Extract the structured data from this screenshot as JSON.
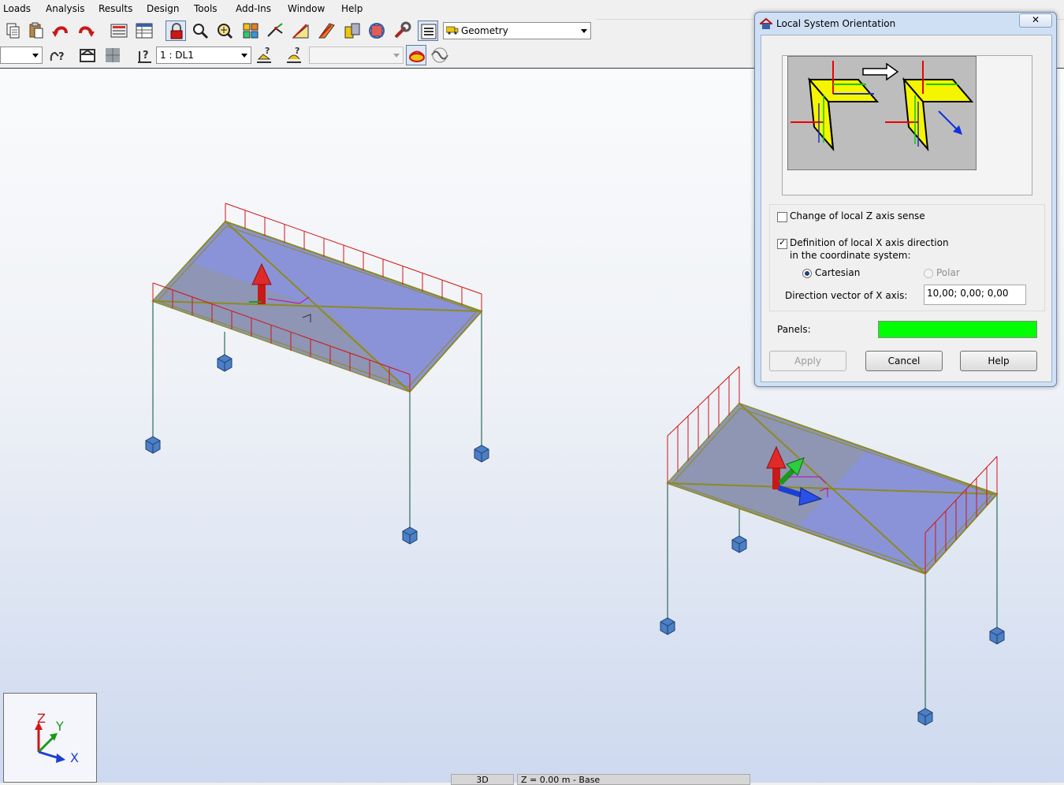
{
  "menu": [
    "Loads",
    "Analysis",
    "Results",
    "Design",
    "Tools",
    "Add-Ins",
    "Window",
    "Help"
  ],
  "toolbar": {
    "layout_selector": {
      "value": "Geometry"
    },
    "load_case_selector": {
      "value": "1 : DL1"
    },
    "empty_selector": {
      "value": ""
    },
    "blank_selector": {
      "value": ""
    }
  },
  "viewport": {
    "axes": {
      "z": "Z",
      "y": "Y",
      "x": "X"
    },
    "status": {
      "view": "3D",
      "level": "Z = 0.00 m - Base"
    }
  },
  "dialog": {
    "title": "Local System Orientation",
    "close_label": "✕",
    "change_z_sense": {
      "label": "Change of local Z axis sense",
      "checked": false
    },
    "define_x_direction": {
      "label": "Definition of local X axis direction",
      "label_line2": "in the coordinate system:",
      "checked": true
    },
    "coordinate_system": {
      "cartesian": {
        "label": "Cartesian",
        "selected": true
      },
      "polar": {
        "label": "Polar",
        "selected": false,
        "enabled": false
      }
    },
    "direction_vector": {
      "label": "Direction vector of X axis:",
      "value": "10,00; 0,00; 0,00"
    },
    "panels": {
      "label": "Panels:",
      "color": "#00ff00"
    },
    "buttons": {
      "apply": "Apply",
      "cancel": "Cancel",
      "help": "Help"
    }
  },
  "colors": {
    "slab": "#8a93d8",
    "slab_shade": "#8e96ad",
    "edge": "#8d8a1e",
    "load": "#d01616",
    "column": "#2d6b5a",
    "support": "#4b7fc6",
    "accent_green": "#00ff00"
  }
}
